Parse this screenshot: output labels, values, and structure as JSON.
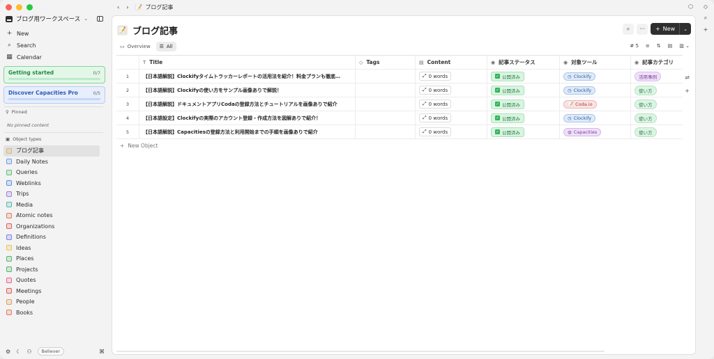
{
  "window": {
    "breadcrumb": "ブログ記事"
  },
  "workspace": {
    "name": "ブログ用ワークスペース"
  },
  "nav": [
    {
      "icon": "plus-icon",
      "label": "New"
    },
    {
      "icon": "search-icon",
      "label": "Search"
    },
    {
      "icon": "calendar-icon",
      "label": "Calendar"
    }
  ],
  "cards": {
    "getting_started": {
      "title": "Getting started",
      "count": "0/7"
    },
    "discover": {
      "title": "Discover Capacities Pro",
      "count": "0/5"
    }
  },
  "pinned": {
    "label": "Pinned",
    "empty": "No pinned content"
  },
  "object_types": {
    "label": "Object types",
    "items": [
      {
        "label": "ブログ記事",
        "color": "#d8b67a"
      },
      {
        "label": "Daily Notes",
        "color": "#6d9be8"
      },
      {
        "label": "Queries",
        "color": "#5cbf7a"
      },
      {
        "label": "Weblinks",
        "color": "#5c8fe0"
      },
      {
        "label": "Trips",
        "color": "#9b7fe0"
      },
      {
        "label": "Media",
        "color": "#4fb8b0"
      },
      {
        "label": "Atomic notes",
        "color": "#e07b5c"
      },
      {
        "label": "Organizations",
        "color": "#e06060"
      },
      {
        "label": "Definitions",
        "color": "#7a7fe8"
      },
      {
        "label": "Ideas",
        "color": "#e8c34f"
      },
      {
        "label": "Places",
        "color": "#4fb86a"
      },
      {
        "label": "Projects",
        "color": "#55b36b"
      },
      {
        "label": "Quotes",
        "color": "#e06b8a"
      },
      {
        "label": "Meetings",
        "color": "#e05c5c"
      },
      {
        "label": "People",
        "color": "#e89a5c"
      },
      {
        "label": "Books",
        "color": "#e07a5c"
      }
    ]
  },
  "footer": {
    "badge": "Believer"
  },
  "page": {
    "emoji": "📝",
    "title": "ブログ記事",
    "new_label": "New",
    "tabs": [
      {
        "label": "Overview"
      },
      {
        "label": "All"
      }
    ],
    "count": "5"
  },
  "table": {
    "headers": {
      "title": "Title",
      "tags": "Tags",
      "content": "Content",
      "status": "記事ステータス",
      "tool": "対象ツール",
      "category": "記事カテゴリ"
    },
    "rows": [
      {
        "num": "1",
        "title": "【日本語解説】Clockifyタイムトラッカーレポートの活用法を紹介！料金プランも徹底…",
        "content": "0 words",
        "status": "公開済み",
        "tool": "Clockify",
        "tool_kind": "clock",
        "category": "活用事例",
        "cat_kind": "case"
      },
      {
        "num": "2",
        "title": "【日本語解説】Clockifyの使い方をサンプル画像ありで解説！",
        "content": "0 words",
        "status": "公開済み",
        "tool": "Clockify",
        "tool_kind": "clock",
        "category": "使い方",
        "cat_kind": "how"
      },
      {
        "num": "3",
        "title": "【日本語解説】ドキュメントアプリCodaの登録方法とチュートリアルを画像ありで紹介",
        "content": "0 words",
        "status": "公開済み",
        "tool": "Coda.io",
        "tool_kind": "coda",
        "category": "使い方",
        "cat_kind": "how"
      },
      {
        "num": "4",
        "title": "【日本語設定】Clockifyの実際のアカウント登録・作成方法を図解ありで紹介！",
        "content": "0 words",
        "status": "公開済み",
        "tool": "Clockify",
        "tool_kind": "clock",
        "category": "使い方",
        "cat_kind": "how"
      },
      {
        "num": "5",
        "title": "【日本語解説】Capacitiesの登録方法と利用開始までの手順を画像ありで紹介",
        "content": "0 words",
        "status": "公開済み",
        "tool": "Capacities",
        "tool_kind": "cap",
        "category": "使い方",
        "cat_kind": "how"
      }
    ],
    "new_object": "New Object"
  }
}
